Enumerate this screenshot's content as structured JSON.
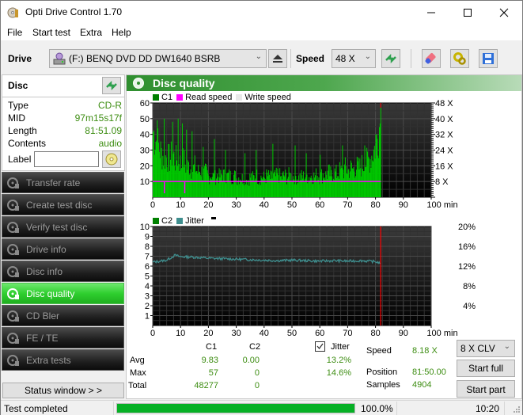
{
  "window": {
    "title": "Opti Drive Control 1.70",
    "controls": {
      "minimize": "minimize",
      "maximize": "maximize",
      "close": "close"
    }
  },
  "menu": [
    "File",
    "Start test",
    "Extra",
    "Help"
  ],
  "toolbar": {
    "drive_label": "Drive",
    "drive_value": "(F:)  BENQ DVD DD DW1640 BSRB",
    "speed_label": "Speed",
    "speed_value": "48 X"
  },
  "disc": {
    "header": "Disc",
    "fields": [
      {
        "key": "Type",
        "value": "CD-R"
      },
      {
        "key": "MID",
        "value": "97m15s17f"
      },
      {
        "key": "Length",
        "value": "81:51.09"
      },
      {
        "key": "Contents",
        "value": "audio"
      }
    ],
    "label_key": "Label",
    "label_value": ""
  },
  "nav": [
    {
      "label": "Transfer rate",
      "active": false
    },
    {
      "label": "Create test disc",
      "active": false
    },
    {
      "label": "Verify test disc",
      "active": false
    },
    {
      "label": "Drive info",
      "active": false
    },
    {
      "label": "Disc info",
      "active": false
    },
    {
      "label": "Disc quality",
      "active": true
    },
    {
      "label": "CD Bler",
      "active": false
    },
    {
      "label": "FE / TE",
      "active": false
    },
    {
      "label": "Extra tests",
      "active": false
    }
  ],
  "status_window_button": "Status window > >",
  "panel_title": "Disc quality",
  "colors": {
    "accent_green": "#2fcf2f",
    "c1_bar": "#00c800",
    "read_speed": "#ff00ff",
    "jitter": "#3f8f8f",
    "end_marker": "#ff0000",
    "value_green": "#3d8d12"
  },
  "chart_data": [
    {
      "type": "bar",
      "title": "C1 / Read speed",
      "legend": [
        "C1",
        "Read speed",
        "Write speed"
      ],
      "legend_colors": [
        "#008000",
        "#ff00ff",
        "#e8e8e8"
      ],
      "xlabel": "min",
      "x_ticks": [
        "0",
        "10",
        "20",
        "30",
        "40",
        "50",
        "60",
        "70",
        "80",
        "90",
        "100 min"
      ],
      "xlim": [
        0,
        100
      ],
      "y_left_ticks": [
        "10",
        "20",
        "30",
        "40",
        "50",
        "60"
      ],
      "ylim_left": [
        0,
        60
      ],
      "y_right_ticks": [
        "8 X",
        "16 X",
        "24 X",
        "32 X",
        "40 X",
        "48 X"
      ],
      "ylim_right": [
        0,
        48
      ],
      "end_marker_min": 81.85,
      "c1_profile": [
        [
          0,
          45
        ],
        [
          1,
          40
        ],
        [
          2,
          35
        ],
        [
          3,
          30
        ],
        [
          4,
          27
        ],
        [
          5,
          28
        ],
        [
          6,
          26
        ],
        [
          7,
          30
        ],
        [
          8,
          25
        ],
        [
          9,
          28
        ],
        [
          10,
          22
        ],
        [
          11,
          26
        ],
        [
          12,
          20
        ],
        [
          13,
          22
        ],
        [
          14,
          18
        ],
        [
          15,
          21
        ],
        [
          16,
          17
        ],
        [
          17,
          19
        ],
        [
          18,
          16
        ],
        [
          19,
          17
        ],
        [
          20,
          14
        ],
        [
          21,
          16
        ],
        [
          22,
          13
        ],
        [
          23,
          15
        ],
        [
          24,
          14
        ],
        [
          25,
          16
        ],
        [
          26,
          13
        ],
        [
          27,
          15
        ],
        [
          28,
          14
        ],
        [
          29,
          15
        ],
        [
          30,
          13
        ],
        [
          31,
          14
        ],
        [
          32,
          13
        ],
        [
          33,
          14
        ],
        [
          34,
          12
        ],
        [
          35,
          14
        ],
        [
          36,
          13
        ],
        [
          37,
          15
        ],
        [
          38,
          13
        ],
        [
          39,
          14
        ],
        [
          40,
          13
        ],
        [
          41,
          15
        ],
        [
          42,
          13
        ],
        [
          43,
          14
        ],
        [
          44,
          14
        ],
        [
          45,
          16
        ],
        [
          46,
          13
        ],
        [
          47,
          15
        ],
        [
          48,
          14
        ],
        [
          49,
          15
        ],
        [
          50,
          14
        ],
        [
          51,
          15
        ],
        [
          52,
          13
        ],
        [
          53,
          14
        ],
        [
          54,
          14
        ],
        [
          55,
          15
        ],
        [
          56,
          14
        ],
        [
          57,
          15
        ],
        [
          58,
          14
        ],
        [
          59,
          16
        ],
        [
          60,
          14
        ],
        [
          61,
          16
        ],
        [
          62,
          15
        ],
        [
          63,
          17
        ],
        [
          64,
          15
        ],
        [
          65,
          17
        ],
        [
          66,
          16
        ],
        [
          67,
          18
        ],
        [
          68,
          17
        ],
        [
          69,
          20
        ],
        [
          70,
          18
        ],
        [
          71,
          20
        ],
        [
          72,
          19
        ],
        [
          73,
          21
        ],
        [
          74,
          20
        ],
        [
          75,
          22
        ],
        [
          76,
          23
        ],
        [
          77,
          25
        ],
        [
          78,
          27
        ],
        [
          79,
          31
        ],
        [
          80,
          36
        ],
        [
          81,
          45
        ],
        [
          81.8,
          57
        ]
      ],
      "c1_spikes": [
        [
          1.5,
          49
        ],
        [
          4,
          50
        ],
        [
          7,
          48
        ],
        [
          9,
          50
        ],
        [
          10.5,
          47
        ],
        [
          12,
          43
        ],
        [
          14,
          42
        ],
        [
          18,
          32
        ],
        [
          22,
          37
        ],
        [
          26,
          30
        ],
        [
          33,
          28
        ],
        [
          37,
          30
        ],
        [
          43,
          34
        ],
        [
          51,
          33
        ],
        [
          55,
          28
        ],
        [
          60,
          27
        ],
        [
          68,
          33
        ],
        [
          76,
          33
        ],
        [
          80,
          40
        ],
        [
          81.8,
          57
        ]
      ],
      "read_speed_x": 8.0
    },
    {
      "type": "line",
      "title": "C2 / Jitter",
      "legend": [
        "C2",
        "Jitter"
      ],
      "legend_colors": [
        "#008000",
        "#3f8f8f"
      ],
      "xlabel": "min",
      "x_ticks": [
        "0",
        "10",
        "20",
        "30",
        "40",
        "50",
        "60",
        "70",
        "80",
        "90",
        "100 min"
      ],
      "xlim": [
        0,
        100
      ],
      "y_left_ticks": [
        "1",
        "2",
        "3",
        "4",
        "5",
        "6",
        "7",
        "8",
        "9",
        "10"
      ],
      "ylim_left": [
        0,
        10
      ],
      "y_right_ticks": [
        "4%",
        "8%",
        "12%",
        "16%",
        "20%"
      ],
      "ylim_right": [
        0,
        20
      ],
      "c2_values": "all 0",
      "jitter_profile_pct": [
        [
          0,
          12.8
        ],
        [
          5,
          13.2
        ],
        [
          8,
          14.2
        ],
        [
          10,
          13.9
        ],
        [
          15,
          13.8
        ],
        [
          20,
          13.6
        ],
        [
          25,
          13.5
        ],
        [
          30,
          13.4
        ],
        [
          35,
          13.3
        ],
        [
          40,
          13.2
        ],
        [
          45,
          13.1
        ],
        [
          50,
          13.2
        ],
        [
          55,
          13.1
        ],
        [
          60,
          13.0
        ],
        [
          65,
          13.1
        ],
        [
          70,
          13.0
        ],
        [
          75,
          13.1
        ],
        [
          80,
          12.9
        ],
        [
          81.8,
          12.6
        ]
      ],
      "end_marker_min": 81.85
    }
  ],
  "stats": {
    "col_c1": "C1",
    "col_c2": "C2",
    "jitter_label": "Jitter",
    "jitter_checked": true,
    "rows": [
      {
        "label": "Avg",
        "c1": "9.83",
        "c2": "0.00",
        "jitter": "13.2%"
      },
      {
        "label": "Max",
        "c1": "57",
        "c2": "0",
        "jitter": "14.6%"
      },
      {
        "label": "Total",
        "c1": "48277",
        "c2": "0",
        "jitter": ""
      }
    ],
    "speed_label": "Speed",
    "speed_value": "8.18 X",
    "position_label": "Position",
    "position_value": "81:50.00",
    "samples_label": "Samples",
    "samples_value": "4904",
    "speed_mode": "8 X CLV",
    "start_full": "Start full",
    "start_part": "Start part"
  },
  "statusbar": {
    "text": "Test completed",
    "progress_pct": 100,
    "progress_text": "100.0%",
    "time": "10:20"
  }
}
